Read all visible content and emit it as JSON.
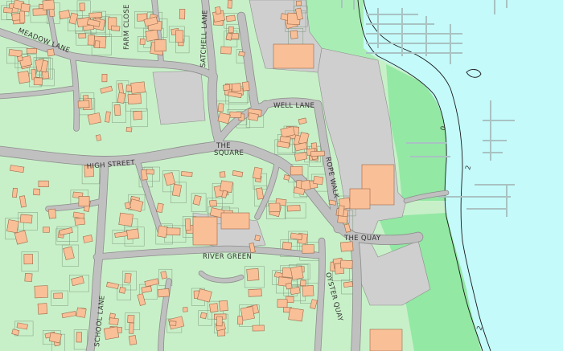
{
  "colors": {
    "land": "#c8f0c8",
    "sea": "#c4fafa",
    "park": "#93e8a4",
    "building": "#f9bf97",
    "road": "#c0c0c0",
    "road_edge": "#8c8c8c",
    "label": "#333333"
  },
  "labels": {
    "meadow_lane": "MEADOW LANE",
    "farm_close": "FARM CLOSE",
    "satchell_lane": "SATCHELL LANE",
    "well_lane": "WELL LANE",
    "the_square_1": "THE",
    "the_square_2": "SQUARE",
    "high_street": "HIGH STREET",
    "rope_walk": "ROPE WALK",
    "the_quay": "THE QUAY",
    "river_green": "RIVER GREEN",
    "oyster_quay": "OYSTER QUAY",
    "school_lane": "SCHOOL LANE",
    "contour_0": "0",
    "contour_2": "2"
  }
}
